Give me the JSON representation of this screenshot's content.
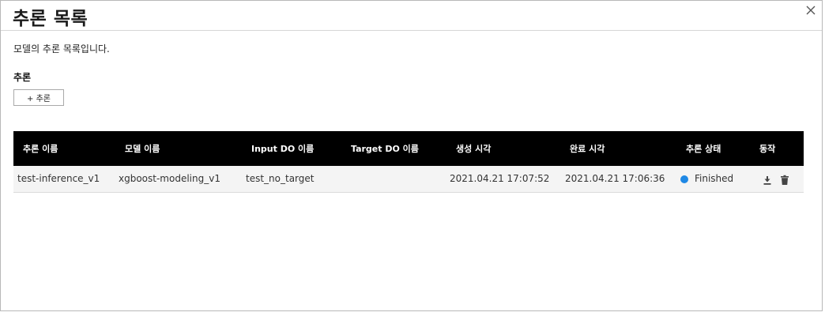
{
  "dialog": {
    "title": "추론 목록",
    "description": "모델의 추론 목록입니다.",
    "section_label": "추론",
    "add_button_label": "+ 추론",
    "close_icon": "close-icon"
  },
  "table": {
    "columns": [
      "추론 이름",
      "모델 이름",
      "Input DO 이름",
      "Target DO 이름",
      "생성 시각",
      "완료 시각",
      "추론 상태",
      "동작"
    ],
    "rows": [
      {
        "inference_name": "test-inference_v1",
        "model_name": "xgboost-modeling_v1",
        "input_do": "test_no_target",
        "target_do": "",
        "created_at": "2021.04.21 17:07:52",
        "completed_at": "2021.04.21 17:06:36",
        "status": "Finished",
        "status_color": "#1e88e5",
        "actions": [
          "download-icon",
          "trash-icon"
        ]
      }
    ]
  },
  "colors": {
    "header_bg": "#000000",
    "row_bg": "#f4f4f4",
    "status_finished": "#1e88e5"
  }
}
